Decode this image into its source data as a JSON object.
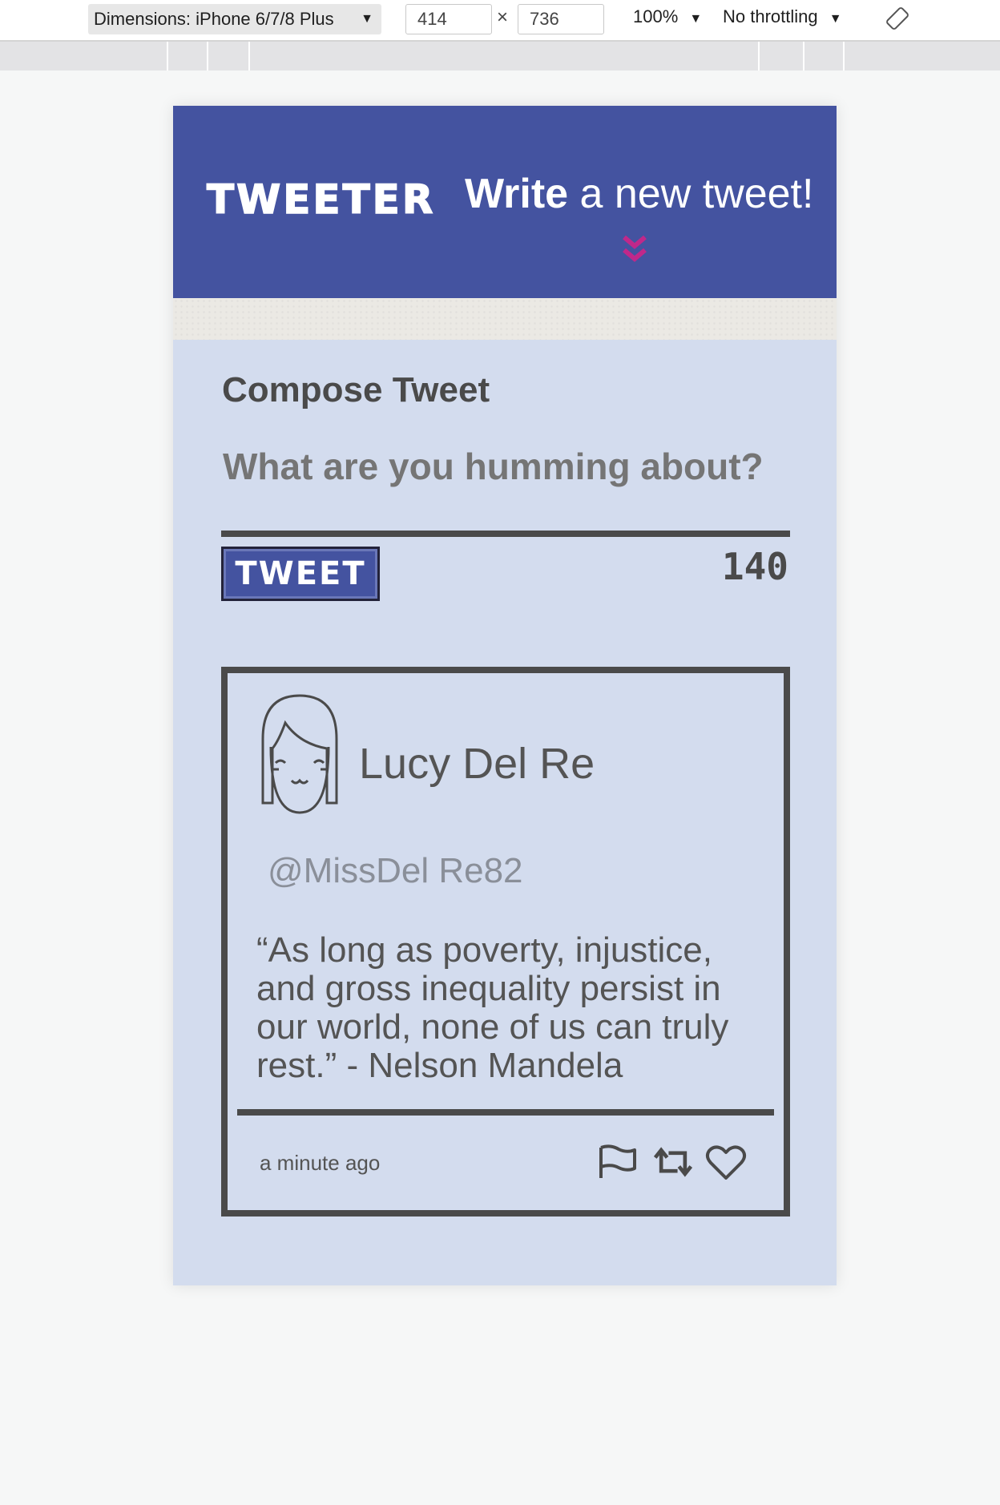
{
  "devtools": {
    "dimensions_label": "Dimensions: iPhone 6/7/8 Plus",
    "width": "414",
    "height": "736",
    "times": "×",
    "zoom": "100%",
    "throttling": "No throttling",
    "dropdown_caret": "▼"
  },
  "nav": {
    "logo": "TWEETER",
    "write_bold": "Write",
    "write_rest": " a new tweet!",
    "chevron_icon": "chevron-double-down-icon",
    "chevron_color": "#c0288a"
  },
  "compose": {
    "title": "Compose Tweet",
    "placeholder": "What are you humming about?",
    "button_label": "TWEET",
    "counter": "140"
  },
  "tweet": {
    "name": "Lucy Del Re",
    "handle": "@MissDel Re82",
    "text": "“As long as poverty, injustice, and gross inequality persist in our world, none of us can truly rest.” - Nelson Mandela",
    "timestamp": "a minute ago",
    "icons": [
      "flag-icon",
      "retweet-icon",
      "heart-icon"
    ]
  },
  "colors": {
    "header": "#4453a0",
    "page": "#d3dcee",
    "text": "#4a4a4a"
  }
}
